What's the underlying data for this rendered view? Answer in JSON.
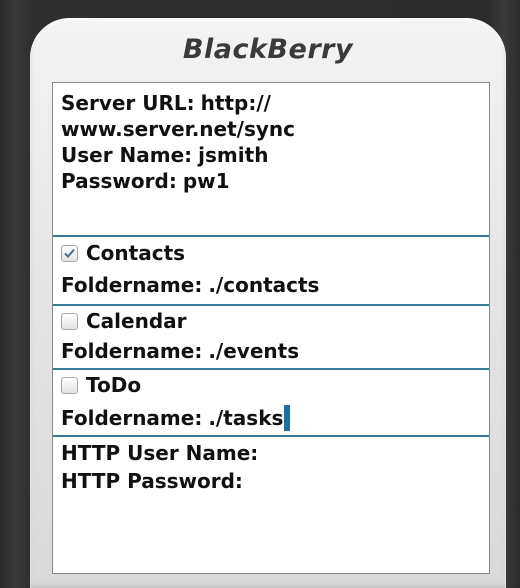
{
  "device": {
    "brand": "BlackBerry"
  },
  "server": {
    "url_label": "Server URL:",
    "url_value_line1": "http://",
    "url_value_line2": "www.server.net/sync",
    "username_label": "User Name:",
    "username_value": "jsmith",
    "password_label": "Password:",
    "password_value": "pw1"
  },
  "sync_items": [
    {
      "label": "Contacts",
      "checked": true,
      "folder_label": "Foldername:",
      "folder_value": "./contacts"
    },
    {
      "label": "Calendar",
      "checked": false,
      "folder_label": "Foldername:",
      "folder_value": "./events"
    },
    {
      "label": "ToDo",
      "checked": false,
      "folder_label": "Foldername:",
      "folder_value": "./tasks"
    }
  ],
  "http": {
    "username_label": "HTTP User Name:",
    "username_value": "",
    "password_label": "HTTP Password:",
    "password_value": ""
  },
  "colors": {
    "divider": "#3a7a95",
    "cursor": "#1f6fa3",
    "check": "#4a6f8a"
  }
}
